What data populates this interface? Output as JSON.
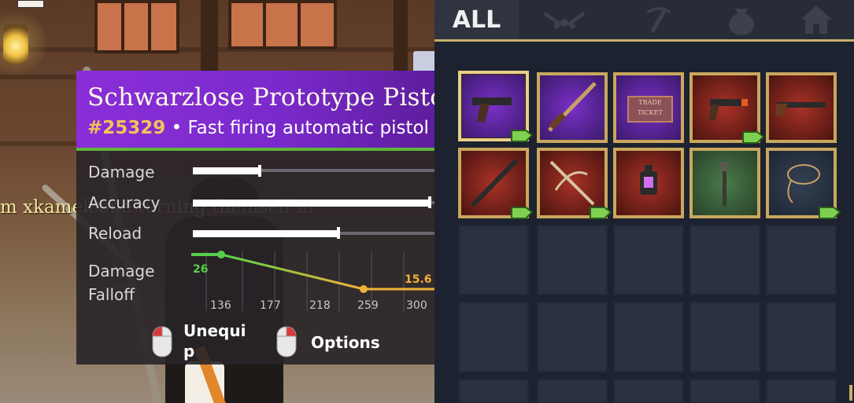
{
  "chat": {
    "text": "m xkamelcone turning themself in"
  },
  "tooltip": {
    "title": "Schwarzlose Prototype Pistol",
    "id": "#25329",
    "bullet": " • ",
    "description": "Fast firing automatic pistol",
    "stats": [
      {
        "label": "Damage",
        "value": 0.27
      },
      {
        "label": "Accuracy",
        "value": 0.96
      },
      {
        "label": "Reload",
        "value": 0.59
      }
    ],
    "falloff": {
      "label_line1": "Damage",
      "label_line2": "Falloff",
      "start_damage": "26",
      "end_damage": "15.6",
      "ticks": [
        "136",
        "177",
        "218",
        "259",
        "300"
      ]
    },
    "actions": [
      {
        "label_line1": "Unequi",
        "label_line2": "p"
      },
      {
        "label": "Options"
      }
    ]
  },
  "inventory": {
    "tabs": [
      {
        "label": "ALL",
        "active": true
      },
      {
        "icon": "crossed-revolvers-icon"
      },
      {
        "icon": "pickaxe-icon"
      },
      {
        "icon": "money-bag-icon"
      },
      {
        "icon": "house-icon"
      }
    ],
    "items": [
      {
        "icon": "pistol-icon",
        "bg": "purple",
        "selected": true,
        "equipped": true
      },
      {
        "icon": "rifle-icon",
        "bg": "purple",
        "selected": false,
        "equipped": false
      },
      {
        "icon": "ticket-icon",
        "bg": "purple",
        "ticket_line1": "TRADE",
        "ticket_line2": "TICKET",
        "equipped": false
      },
      {
        "icon": "revolver-icon",
        "bg": "red",
        "equipped": true
      },
      {
        "icon": "shotgun-icon",
        "bg": "red",
        "equipped": false
      },
      {
        "icon": "sniper-rifle-icon",
        "bg": "red",
        "equipped": true
      },
      {
        "icon": "crossbow-icon",
        "bg": "red",
        "equipped": true
      },
      {
        "icon": "lantern-icon",
        "bg": "red",
        "equipped": false
      },
      {
        "icon": "shovel-icon",
        "bg": "green",
        "equipped": false
      },
      {
        "icon": "lasso-icon",
        "bg": "dark",
        "equipped": true
      }
    ],
    "colors": {
      "gold_border": "#c9a75e",
      "equipped_badge": "#7ed050",
      "tab_accent": "#c8b06a"
    }
  }
}
